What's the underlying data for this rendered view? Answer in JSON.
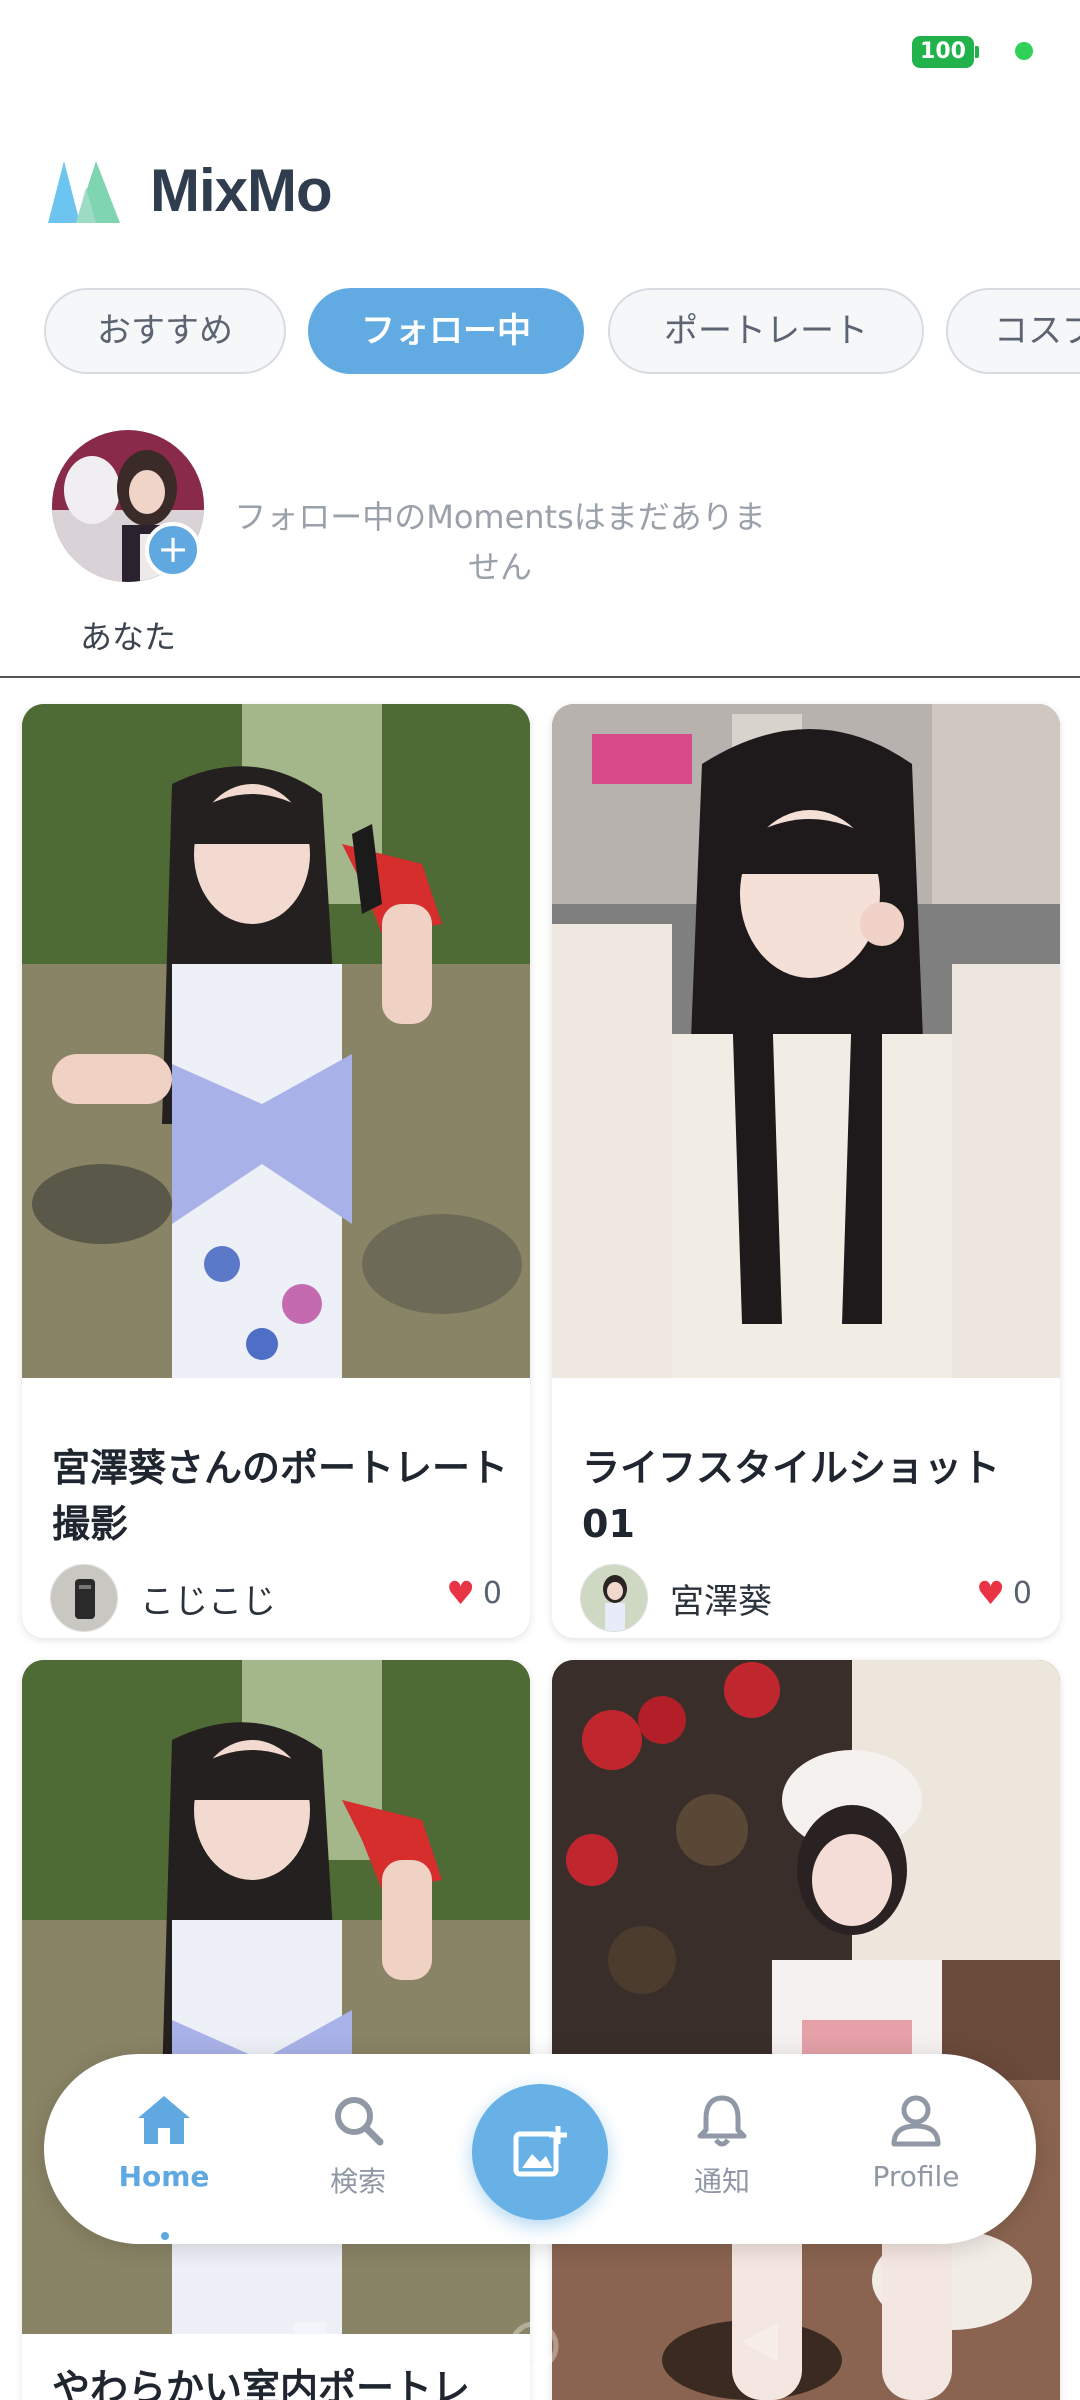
{
  "status_bar": {
    "battery": "100"
  },
  "app": {
    "title": "MixMo"
  },
  "tabs": [
    {
      "label": "おすすめ"
    },
    {
      "label": "フォロー中",
      "active": true
    },
    {
      "label": "ポートレート"
    },
    {
      "label": "コスプ"
    }
  ],
  "moments": {
    "you_label": "あなた",
    "empty_message": "フォロー中のMomentsはまだありません"
  },
  "posts": [
    {
      "title": "宮澤葵さんのポートレート撮影",
      "author": "こじこじ",
      "likes": "0"
    },
    {
      "title": "ライフスタイルショット01",
      "author": "宮澤葵",
      "likes": "0"
    },
    {
      "title": "やわらかい室内ポートレ",
      "author": "",
      "likes": ""
    },
    {
      "title": "",
      "author": "",
      "likes": ""
    }
  ],
  "bottom_nav": {
    "home": "Home",
    "search": "検索",
    "notifications": "通知",
    "profile": "Profile"
  },
  "colors": {
    "accent": "#5fa8e0",
    "like": "#e93446",
    "battery": "#22b24c"
  }
}
